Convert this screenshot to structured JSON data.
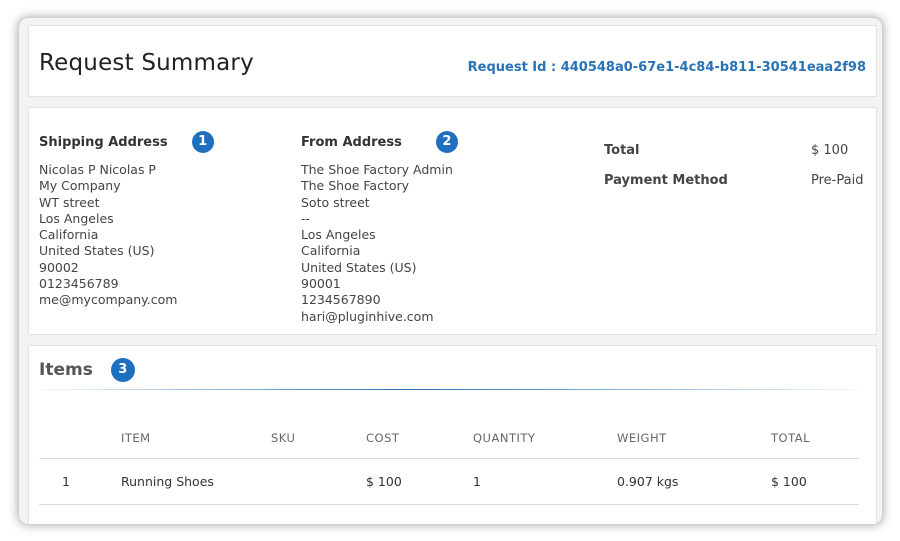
{
  "header": {
    "title": "Request Summary",
    "request_id": "Request Id : 440548a0-67e1-4c84-b811-30541eaa2f98"
  },
  "shipping": {
    "heading": "Shipping Address",
    "badge": "1",
    "lines": [
      "Nicolas P Nicolas P",
      "My Company",
      "WT street",
      "Los Angeles",
      "California",
      "United States (US)",
      "90002",
      "0123456789",
      "me@mycompany.com"
    ]
  },
  "from": {
    "heading": "From Address",
    "badge": "2",
    "lines": [
      "The Shoe Factory Admin",
      "The Shoe Factory",
      "Soto street",
      "--",
      "Los Angeles",
      "California",
      "United States (US)",
      "90001",
      "1234567890",
      "hari@pluginhive.com"
    ]
  },
  "summary": {
    "total_label": "Total",
    "total_value": "$ 100",
    "payment_label": "Payment Method",
    "payment_value": "Pre-Paid"
  },
  "items": {
    "title": "Items",
    "badge": "3",
    "columns": [
      "",
      "ITEM",
      "SKU",
      "COST",
      "QUANTITY",
      "WEIGHT",
      "TOTAL"
    ],
    "rows": [
      {
        "index": "1",
        "item": "Running Shoes",
        "sku": "",
        "cost": "$ 100",
        "quantity": "1",
        "weight": "0.907 kgs",
        "total": "$ 100"
      }
    ]
  },
  "colors": {
    "accent": "#2a72b8",
    "badge": "#1f6fc0"
  }
}
